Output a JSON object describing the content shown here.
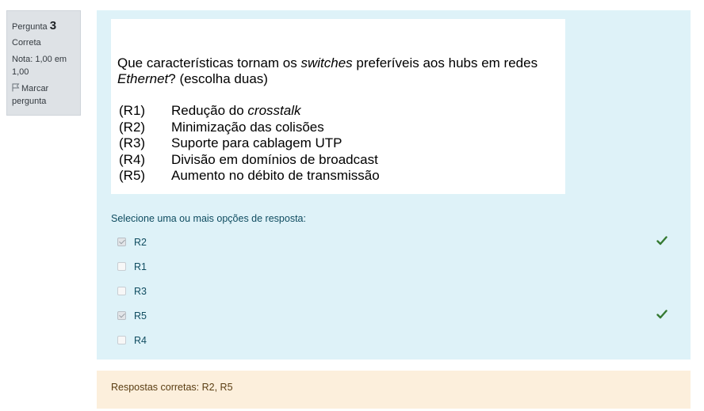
{
  "info": {
    "question_label": "Pergunta",
    "question_number": "3",
    "state": "Correta",
    "grade": "Nota: 1,00 em 1,00",
    "flag_label": "Marcar pergunta"
  },
  "question_image": {
    "question_parts": [
      "Que características tornam os ",
      "switches",
      " preferíveis aos hubs em redes ",
      "Ethernet",
      "? (escolha duas)"
    ],
    "options": [
      {
        "code": "(R1)",
        "text": "Redução do ",
        "italic": "crosstalk"
      },
      {
        "code": "(R2)",
        "text": "Minimização das colisões",
        "italic": ""
      },
      {
        "code": "(R3)",
        "text": "Suporte para cablagem UTP",
        "italic": ""
      },
      {
        "code": "(R4)",
        "text": "Divisão em domínios de broadcast",
        "italic": ""
      },
      {
        "code": "(R5)",
        "text": "Aumento no débito de transmissão",
        "italic": ""
      }
    ]
  },
  "prompt": "Selecione uma ou mais opções de resposta:",
  "answers": [
    {
      "label": "R2",
      "checked": true,
      "correct": true
    },
    {
      "label": "R1",
      "checked": false,
      "correct": false
    },
    {
      "label": "R3",
      "checked": false,
      "correct": false
    },
    {
      "label": "R5",
      "checked": true,
      "correct": true
    },
    {
      "label": "R4",
      "checked": false,
      "correct": false
    }
  ],
  "feedback": "Respostas corretas: R2, R5",
  "colors": {
    "content_bg": "#def2f8",
    "feedback_bg": "#fcefdc",
    "tick": "#357a32",
    "info_bg": "#dee2e6"
  }
}
